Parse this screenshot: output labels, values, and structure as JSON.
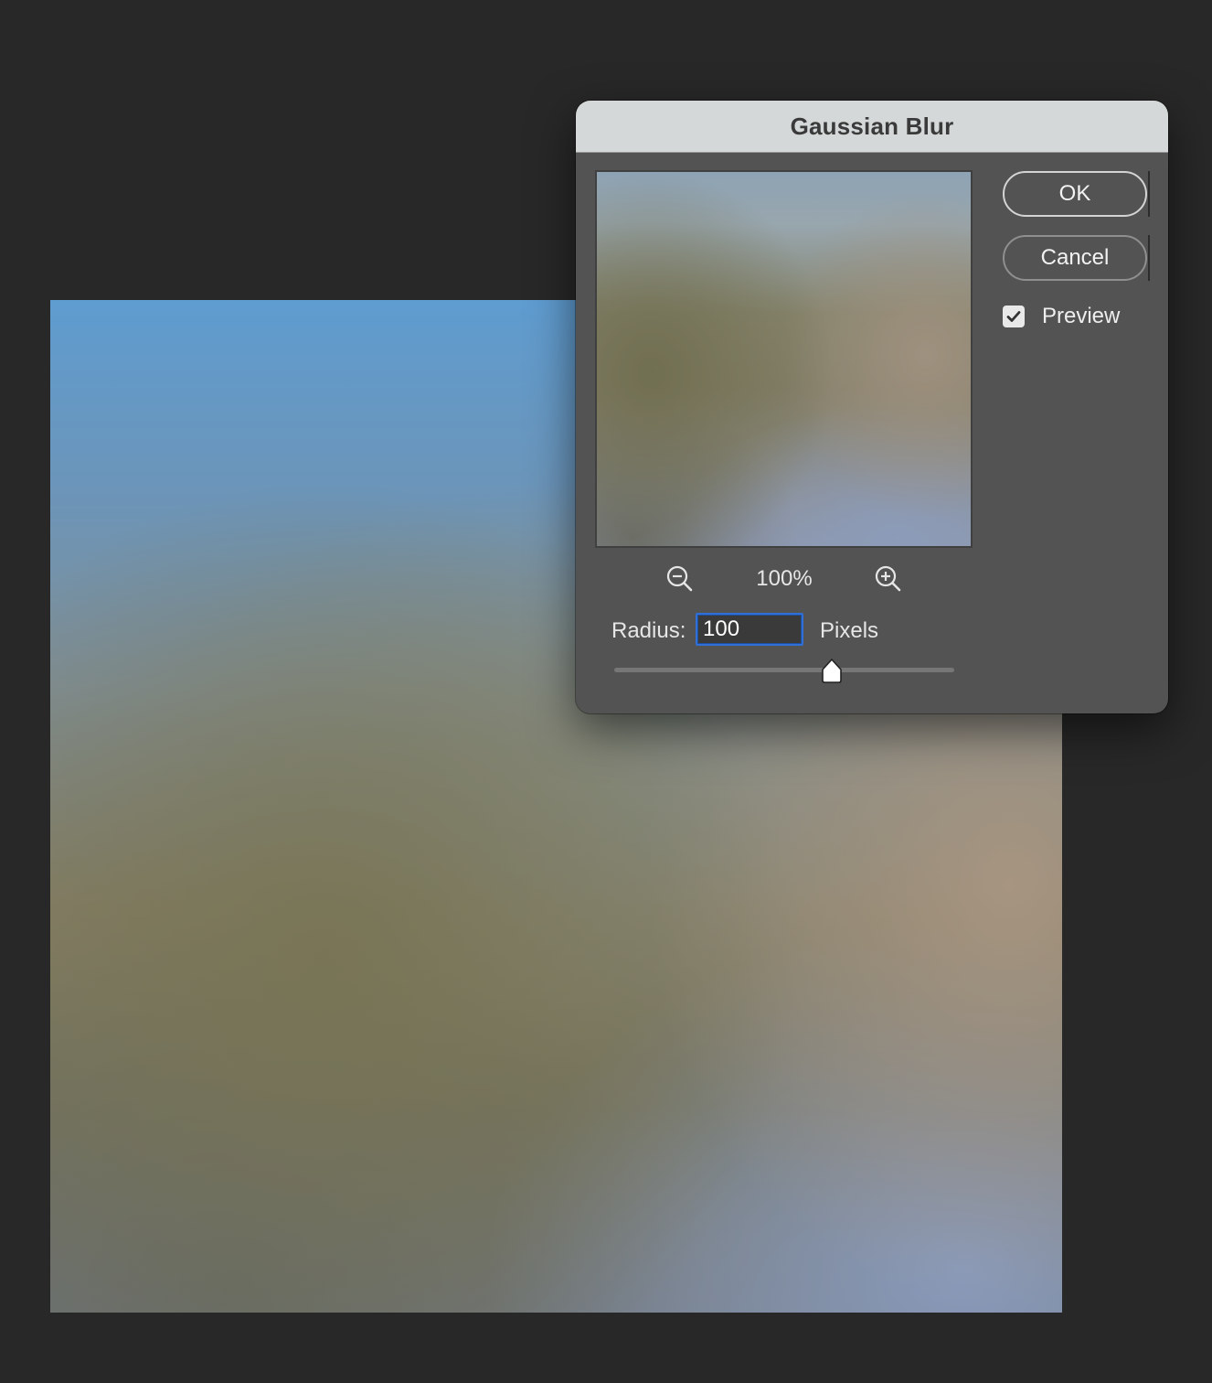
{
  "dialog": {
    "title": "Gaussian Blur",
    "ok_label": "OK",
    "cancel_label": "Cancel",
    "preview_label": "Preview",
    "preview_checked": true,
    "zoom_level": "100%",
    "radius_label": "Radius:",
    "radius_value": "100",
    "radius_unit": "Pixels",
    "slider_position": 0.64
  },
  "icons": {
    "zoom_out": "zoom-out-icon",
    "zoom_in": "zoom-in-icon",
    "checkmark": "checkmark-icon",
    "slider_thumb": "slider-thumb-icon"
  },
  "colors": {
    "workspace": "#282828",
    "dialog_body": "#535353",
    "titlebar": "#d5d8d8",
    "input_focus": "#2f6fd6"
  }
}
